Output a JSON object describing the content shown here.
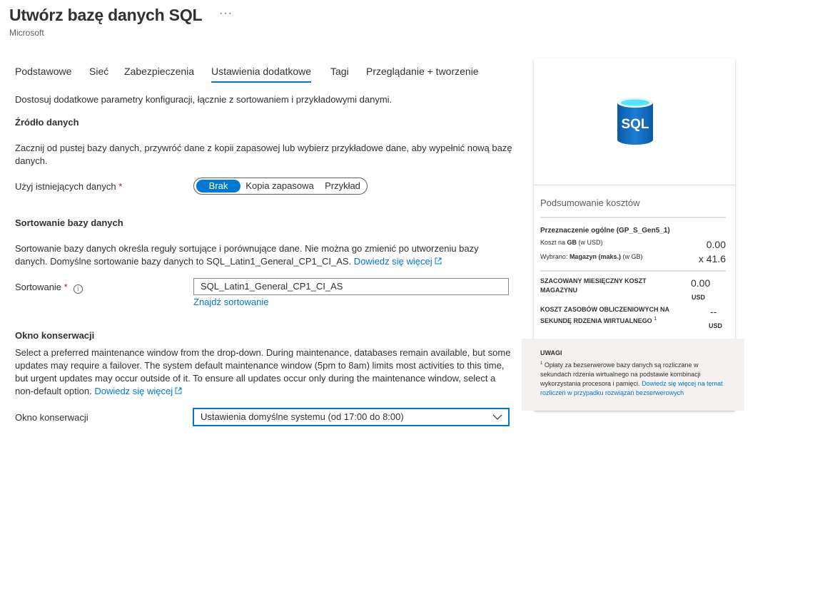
{
  "header": {
    "title": "Utwórz bazę danych SQL",
    "more_label": "···",
    "subtitle": "Microsoft"
  },
  "tabs": [
    {
      "label": "Podstawowe"
    },
    {
      "label": "Sieć"
    },
    {
      "label": "Zabezpieczenia"
    },
    {
      "label": "Ustawienia dodatkowe",
      "active": true
    },
    {
      "label": "Tagi"
    },
    {
      "label": "Przeglądanie + tworzenie"
    }
  ],
  "intro": "Dostosuj dodatkowe parametry konfiguracji, łącznie z sortowaniem i przykładowymi danymi.",
  "data_source": {
    "heading": "Źródło danych",
    "description": "Zacznij od pustej bazy danych, przywróć dane z kopii zapasowej lub wybierz przykładowe dane, aby wypełnić nową bazę danych.",
    "field_label": "Użyj istniejących danych",
    "required_mark": "*",
    "options": [
      "Brak",
      "Kopia zapasowa",
      "Przykład"
    ],
    "selected": "Brak"
  },
  "collation": {
    "heading": "Sortowanie bazy danych",
    "description": "Sortowanie bazy danych określa reguły sortujące i porównujące dane. Nie można go zmienić po utworzeniu bazy danych. Domyślne sortowanie bazy danych to SQL_Latin1_General_CP1_CI_AS.",
    "learn_more": "Dowiedz się więcej",
    "field_label": "Sortowanie",
    "required_mark": "*",
    "value": "SQL_Latin1_General_CP1_CI_AS",
    "find_link": "Znajdź sortowanie"
  },
  "maintenance": {
    "heading": "Okno konserwacji",
    "description": "Select a preferred maintenance window from the drop-down. During maintenance, databases remain available, but some updates may require a failover. The system default maintenance window (5pm to 8am) limits most activities to this time, but urgent updates may occur outside of it. To ensure all updates occur only during the maintenance window, select a non-default option.",
    "learn_more": "Dowiedz się więcej",
    "field_label": "Okno konserwacji",
    "value": "Ustawienia domyślne systemu (od 17:00 do 8:00)"
  },
  "summary": {
    "logo_text": "SQL",
    "title": "Podsumowanie kosztów",
    "allocation_label": "Przeznaczenie ogólne (GP_S_Gen5_1)",
    "cost_per_gb_label_pre": "Koszt na ",
    "cost_per_gb_label_b": "GB",
    "cost_per_gb_label_post": " (w USD)",
    "cost_per_gb_value": "0.00",
    "selected_label_pre": "Wybrano: ",
    "selected_label_b": "Magazyn (maks.)",
    "selected_label_post": " (w GB)",
    "selected_value": "x 41.6",
    "monthly_storage_label": "SZACOWANY MIESIĘCZNY KOSZT MAGAZYNU",
    "monthly_storage_value": "0.00",
    "monthly_storage_unit": "USD",
    "compute_label": "KOSZT ZASOBÓW OBLICZENIOWYCH NA SEKUNDĘ RDZENIA WIRTUALNEGO",
    "compute_sup": "1",
    "compute_value": "--",
    "compute_unit": "USD",
    "notes_title": "UWAGI",
    "notes_sup": "1",
    "notes_text": " Opłaty za bezserwerowe bazy danych są rozliczane w sekundach rdzenia wirtualnego na podstawie kombinacji wykorzystania procesora i pamięci. ",
    "notes_link": "Dowiedz się więcej na temat rozliczeń w przypadku rozwiązań bezserwerowych"
  },
  "colors": {
    "accent": "#0078d4",
    "required": "#a4262c",
    "sql_blue": "#0a6ec0"
  }
}
